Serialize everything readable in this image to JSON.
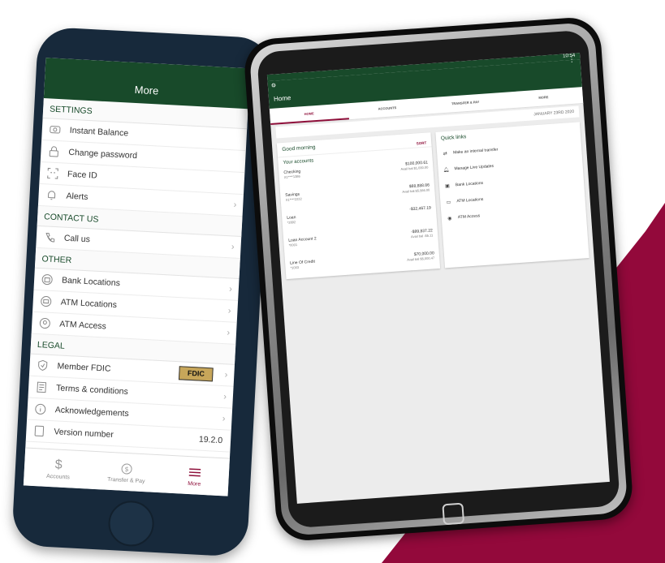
{
  "colors": {
    "brand_green": "#184a2a",
    "accent_maroon": "#8e0f3a",
    "fdic_gold": "#c7a65a"
  },
  "phone": {
    "header": {
      "title": "More"
    },
    "sections": [
      {
        "title": "SETTINGS",
        "items": [
          {
            "label": "Instant Balance",
            "icon": "instant-balance-icon"
          },
          {
            "label": "Change password",
            "icon": "lock-icon"
          },
          {
            "label": "Face ID",
            "icon": "face-id-icon"
          },
          {
            "label": "Alerts",
            "icon": "bell-icon"
          }
        ]
      },
      {
        "title": "CONTACT US",
        "items": [
          {
            "label": "Call us",
            "icon": "phone-icon"
          }
        ]
      },
      {
        "title": "OTHER",
        "items": [
          {
            "label": "Bank Locations",
            "icon": "bank-icon"
          },
          {
            "label": "ATM Locations",
            "icon": "atm-icon"
          },
          {
            "label": "ATM Access",
            "icon": "location-pin-icon"
          }
        ]
      },
      {
        "title": "LEGAL",
        "items": [
          {
            "label": "Member FDIC",
            "icon": "shield-icon",
            "badge": "FDIC"
          },
          {
            "label": "Terms & conditions",
            "icon": "document-icon"
          },
          {
            "label": "Acknowledgements",
            "icon": "info-icon"
          },
          {
            "label": "Version number",
            "icon": "device-icon",
            "value": "19.2.0"
          }
        ]
      }
    ],
    "tabbar": [
      {
        "label": "Accounts",
        "icon": "dollar-icon"
      },
      {
        "label": "Transfer & Pay",
        "icon": "transfer-icon"
      },
      {
        "label": "More",
        "icon": "menu-icon",
        "active": true
      }
    ]
  },
  "tablet": {
    "status_time": "10:54",
    "header": {
      "title": "Home"
    },
    "tabs": [
      {
        "label": "HOME",
        "active": true
      },
      {
        "label": "ACCOUNTS"
      },
      {
        "label": "TRANSFER & PAY"
      },
      {
        "label": "MORE"
      }
    ],
    "date": "JANUARY 23RD 2020",
    "greeting": "Good morning",
    "accounts_title": "Your accounts",
    "sort_label": "SORT",
    "accounts": [
      {
        "name": "Checking",
        "number": "X1****1386",
        "balance": "$100,000.61",
        "avail": "Avail bal $1,000.00"
      },
      {
        "name": "Savings",
        "number": "X1****2222",
        "balance": "$88,888.86",
        "avail": "Avail bal $5,566.00"
      },
      {
        "name": "Loan",
        "number": "*2892",
        "balance": "-$32,467.19",
        "avail": ""
      },
      {
        "name": "Loan Account 2",
        "number": "*0001",
        "balance": "-$99,837.22",
        "avail": "Avail bal -$5.11"
      },
      {
        "name": "Line Of Credit",
        "number": "*1003",
        "balance": "$70,000.00",
        "avail": "Avail bal $5,000.47"
      }
    ],
    "quick_links_title": "Quick links",
    "quick_links": [
      {
        "label": "Make an internal transfer",
        "icon": "transfer-icon"
      },
      {
        "label": "Manage Live Updates",
        "icon": "bell-icon"
      },
      {
        "label": "Bank Locations",
        "icon": "bank-icon"
      },
      {
        "label": "ATM Locations",
        "icon": "atm-icon"
      },
      {
        "label": "ATM Access",
        "icon": "location-pin-icon"
      }
    ]
  }
}
